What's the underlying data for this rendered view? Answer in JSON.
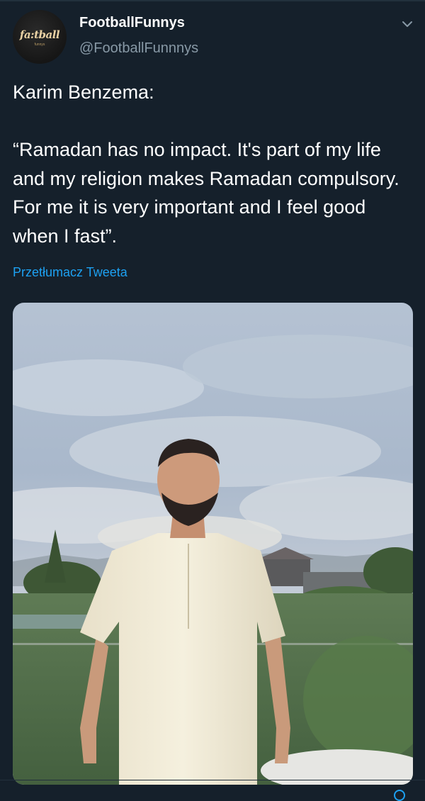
{
  "tweet": {
    "avatar": {
      "logo_text": "fa:tball",
      "logo_sub": "funnys",
      "logo_color": "#e9d1a4"
    },
    "display_name": "FootballFunnys",
    "handle": "@FootballFunnnys",
    "more_icon": "chevron-down-icon",
    "text_line_1": "Karim Benzema:",
    "text_line_2": "“Ramadan has no impact. It's part of my life and my religion makes Ramadan compulsory. For me it is very important and I feel good when I fast”.",
    "translate_label": "Przetłumacz Tweeta",
    "media_icon": "photo"
  },
  "colors": {
    "background": "#15202b",
    "secondary_text": "#8899a6",
    "link": "#1da1f2",
    "divider": "#22303c"
  }
}
